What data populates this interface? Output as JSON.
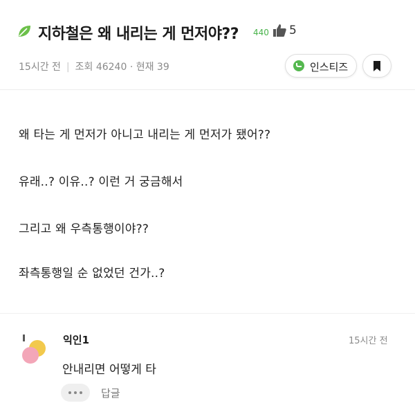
{
  "post": {
    "title": "지하철은 왜 내리는 게 먼저야??",
    "view_badge": "440",
    "likes": "5",
    "time_ago": "15시간 전",
    "views_text": "조회 46240 · 현재 39",
    "instiz_label": "인스티즈",
    "body_lines": [
      "왜 타는 게 먼저가 아니고 내리는 게 먼저가 됐어??",
      "유래..? 이유..? 이런 거 궁금해서",
      "그리고 왜 우측통행이야??",
      "좌측통행일 순 없었던 건가..?"
    ]
  },
  "comment": {
    "author": "익인1",
    "time": "15시간 전",
    "text": "안내리면 어떻게 타",
    "reply_label": "답글"
  },
  "colors": {
    "accent_green": "#49b34b",
    "muted_text": "#8a8a8a"
  },
  "icons": [
    "leaf-icon",
    "thumbs-up-icon",
    "instiz-logo-icon",
    "bookmark-icon",
    "avatar",
    "more-icon"
  ]
}
